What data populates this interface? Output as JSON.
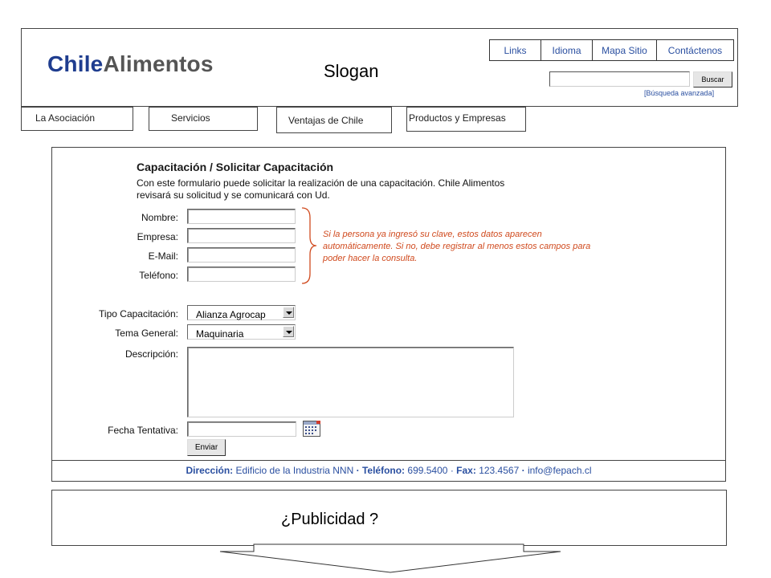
{
  "header": {
    "logo_part1": "Chile",
    "logo_part2": "Alimentos",
    "slogan": "Slogan",
    "top_links": [
      "Links",
      "Idioma",
      "Mapa Sitio",
      "Contáctenos"
    ],
    "search": {
      "value": "",
      "button_label": "Buscar",
      "advanced_link": "[Búsqueda avanzada]"
    }
  },
  "nav": {
    "tabs": [
      "La Asociación",
      "Servicios",
      "Ventajas de Chile",
      "Productos y Empresas"
    ]
  },
  "form": {
    "title": "Capacitación / Solicitar Capacitación",
    "intro": "Con este formulario puede solicitar la realización de una capacitación. Chile Alimentos revisará su solicitud y se comunicará con Ud.",
    "fields": {
      "nombre": {
        "label": "Nombre:",
        "value": ""
      },
      "empresa": {
        "label": "Empresa:",
        "value": ""
      },
      "email": {
        "label": "E-Mail:",
        "value": ""
      },
      "telefono": {
        "label": "Teléfono:",
        "value": ""
      },
      "tipo": {
        "label": "Tipo Capacitación:",
        "selected": "Alianza Agrocap"
      },
      "tema": {
        "label": "Tema General:",
        "selected": "Maquinaria"
      },
      "descripcion": {
        "label": "Descripción:",
        "value": ""
      },
      "fecha": {
        "label": "Fecha Tentativa:",
        "value": ""
      }
    },
    "note": "Si la persona ya ingresó su clave, estos datos aparecen automáticamente. Si no, debe registrar al menos estos campos para poder hacer la consulta.",
    "submit_label": "Enviar"
  },
  "footer": {
    "address_label": "Dirección:",
    "address": "Edificio de la Industria NNN",
    "phone_label": "Teléfono:",
    "phone": "699.5400",
    "fax_label": "Fax:",
    "fax": "123.4567",
    "email": "info@fepach.cl",
    "separator": "·"
  },
  "ad": {
    "text": "¿Publicidad ?"
  },
  "colors": {
    "brand_blue": "#1f3d8f",
    "link_blue": "#2a4fa0",
    "note_orange": "#d04a1e",
    "logo_gray": "#555555"
  },
  "icons": {
    "calendar": "calendar-icon",
    "dropdown": "chevron-down-icon",
    "brace": "brace-icon",
    "arrow": "arrow-down-icon"
  }
}
